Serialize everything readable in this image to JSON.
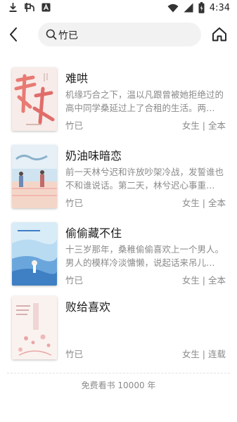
{
  "status_bar": {
    "time": "4:34",
    "left_icons": [
      "download-icon",
      "app-notification-icon",
      "app-badge-icon"
    ],
    "right_icons": [
      "wifi-icon",
      "signal-icon",
      "battery-icon"
    ]
  },
  "search": {
    "query": "竹已"
  },
  "books": [
    {
      "title": "难哄",
      "description": "机缘巧合之下，温以凡跟曾被她拒绝过的高中同学桑延过上了合租的生活。两…",
      "author": "竹已",
      "meta": "女生 | 全本",
      "cover_colors": [
        "#f7ece9",
        "#e87a74"
      ]
    },
    {
      "title": "奶油味暗恋",
      "description": "前一天林兮迟和许放吵架冷战，发誓谁也不和谁说话。第二天，林兮迟心事重…",
      "author": "竹已",
      "meta": "女生 | 全本",
      "cover_colors": [
        "#cfe3f0",
        "#f3b7b0"
      ]
    },
    {
      "title": "偷偷藏不住",
      "description": "十三岁那年，桑稚偷偷喜欢上一个男人。男人的模样冷淡慵懒，说起话来吊儿…",
      "author": "竹已",
      "meta": "女生 | 全本",
      "cover_colors": [
        "#d8ecf8",
        "#6aa6dc"
      ]
    },
    {
      "title": "败给喜欢",
      "description": "",
      "author": "竹已",
      "meta": "女生 | 连载",
      "cover_colors": [
        "#faf2ef",
        "#e8a7a7"
      ]
    }
  ],
  "footer": {
    "text": "免费看书 10000 年"
  }
}
